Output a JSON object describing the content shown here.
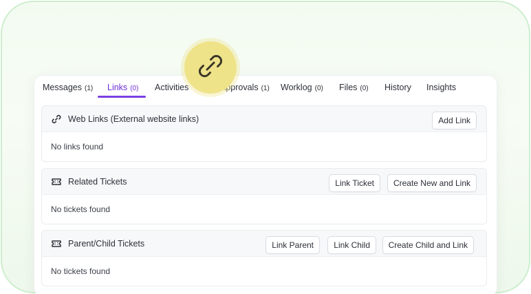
{
  "tabs": [
    {
      "label": "Messages",
      "count": "(1)"
    },
    {
      "label": "Links",
      "count": "(0)"
    },
    {
      "label": "Activities",
      "count": ""
    },
    {
      "label": "Approvals",
      "count": "(1)"
    },
    {
      "label": "Worklog",
      "count": "(0)"
    },
    {
      "label": "Files",
      "count": "(0)"
    },
    {
      "label": "History",
      "count": ""
    },
    {
      "label": "Insights",
      "count": ""
    }
  ],
  "active_tab": "Links",
  "sections": {
    "web_links": {
      "title": "Web Links (External website links)",
      "icon": "link-icon",
      "empty": "No links found",
      "buttons": {
        "add_link": "Add Link"
      }
    },
    "related": {
      "title": "Related Tickets",
      "icon": "ticket-icon",
      "empty": "No tickets found",
      "buttons": {
        "link_ticket": "Link Ticket",
        "create_new_and_link": "Create New and Link"
      }
    },
    "parent_child": {
      "title": "Parent/Child Tickets",
      "icon": "ticket-icon",
      "empty": "No tickets found",
      "buttons": {
        "link_parent": "Link Parent",
        "link_child": "Link Child",
        "create_child_and_link": "Create Child and Link"
      }
    }
  },
  "colors": {
    "accent": "#7b3fe4",
    "badge": "#efe38a",
    "frame_border": "#cdeecf"
  }
}
